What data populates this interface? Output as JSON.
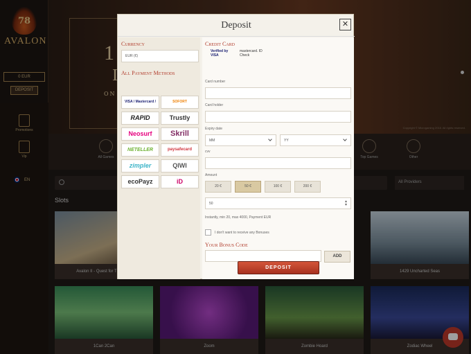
{
  "sidebar": {
    "logo_number": "78",
    "brand": "AVALON",
    "balance": "0 EUR",
    "deposit_label": "DEPOSIT",
    "items": [
      {
        "label": "Promotions"
      },
      {
        "label": "Vip"
      }
    ],
    "lang": "EN"
  },
  "banner": {
    "line1": "1",
    "line2": "I",
    "line3": "ON",
    "copyright": "Copyright © Microgaming 2018. All rights reserved."
  },
  "categories": [
    {
      "label": "All Games"
    },
    {
      "label": "Top Games"
    },
    {
      "label": "Other"
    }
  ],
  "search": {
    "placeholder": "Search game"
  },
  "providers": {
    "label": "All Providers"
  },
  "slots_title": "Slots",
  "games": [
    {
      "name": "Avalon II - Quest for The Grail"
    },
    {
      "name": "1429 Uncharted Seas"
    },
    {
      "name": "1Can 2Can"
    },
    {
      "name": "Zoom"
    },
    {
      "name": "Zombie Hoard"
    },
    {
      "name": "Zodiac Wheel"
    }
  ],
  "modal": {
    "title": "Deposit",
    "close": "✕",
    "currency_title": "Currency",
    "currency_value": "EUR (€)",
    "payment_title": "All Payment Methods",
    "payment_methods": [
      {
        "name": "VISA / Mastercard / Maestro"
      },
      {
        "name": "SOFORT ÜBERWEISUNG"
      },
      {
        "name": "RAPID"
      },
      {
        "name": "Trustly"
      },
      {
        "name": "Neosurf"
      },
      {
        "name": "Skrill"
      },
      {
        "name": "NETELLER"
      },
      {
        "name": "paysafecard"
      },
      {
        "name": "zimpler"
      },
      {
        "name": "QIWI"
      },
      {
        "name": "ecoPayz"
      },
      {
        "name": "iD"
      }
    ],
    "credit_card_title": "Credit Card",
    "verified_visa": "Verified by VISA",
    "mastercard_check": "mastercard. ID Check",
    "card_number_label": "Card number",
    "card_holder_label": "Card holder",
    "expiry_label": "Expiry date",
    "expiry_month": "MM",
    "expiry_year": "YY",
    "cvv_label": "cvv",
    "amount_label": "Amount",
    "amounts": [
      "20 €",
      "50 €",
      "100 €",
      "200 €"
    ],
    "amount_value": "50",
    "limits": "Instantly, min 20, max 4000, Payment EUR",
    "no_bonus_label": "I don't want to receive any Bonuses",
    "bonus_title": "Your Bonus Code",
    "add_label": "ADD",
    "deposit_button": "DEPOSIT"
  },
  "colors": {
    "accent": "#b03a2a",
    "button": "#c0442c",
    "gold": "#a58550"
  }
}
